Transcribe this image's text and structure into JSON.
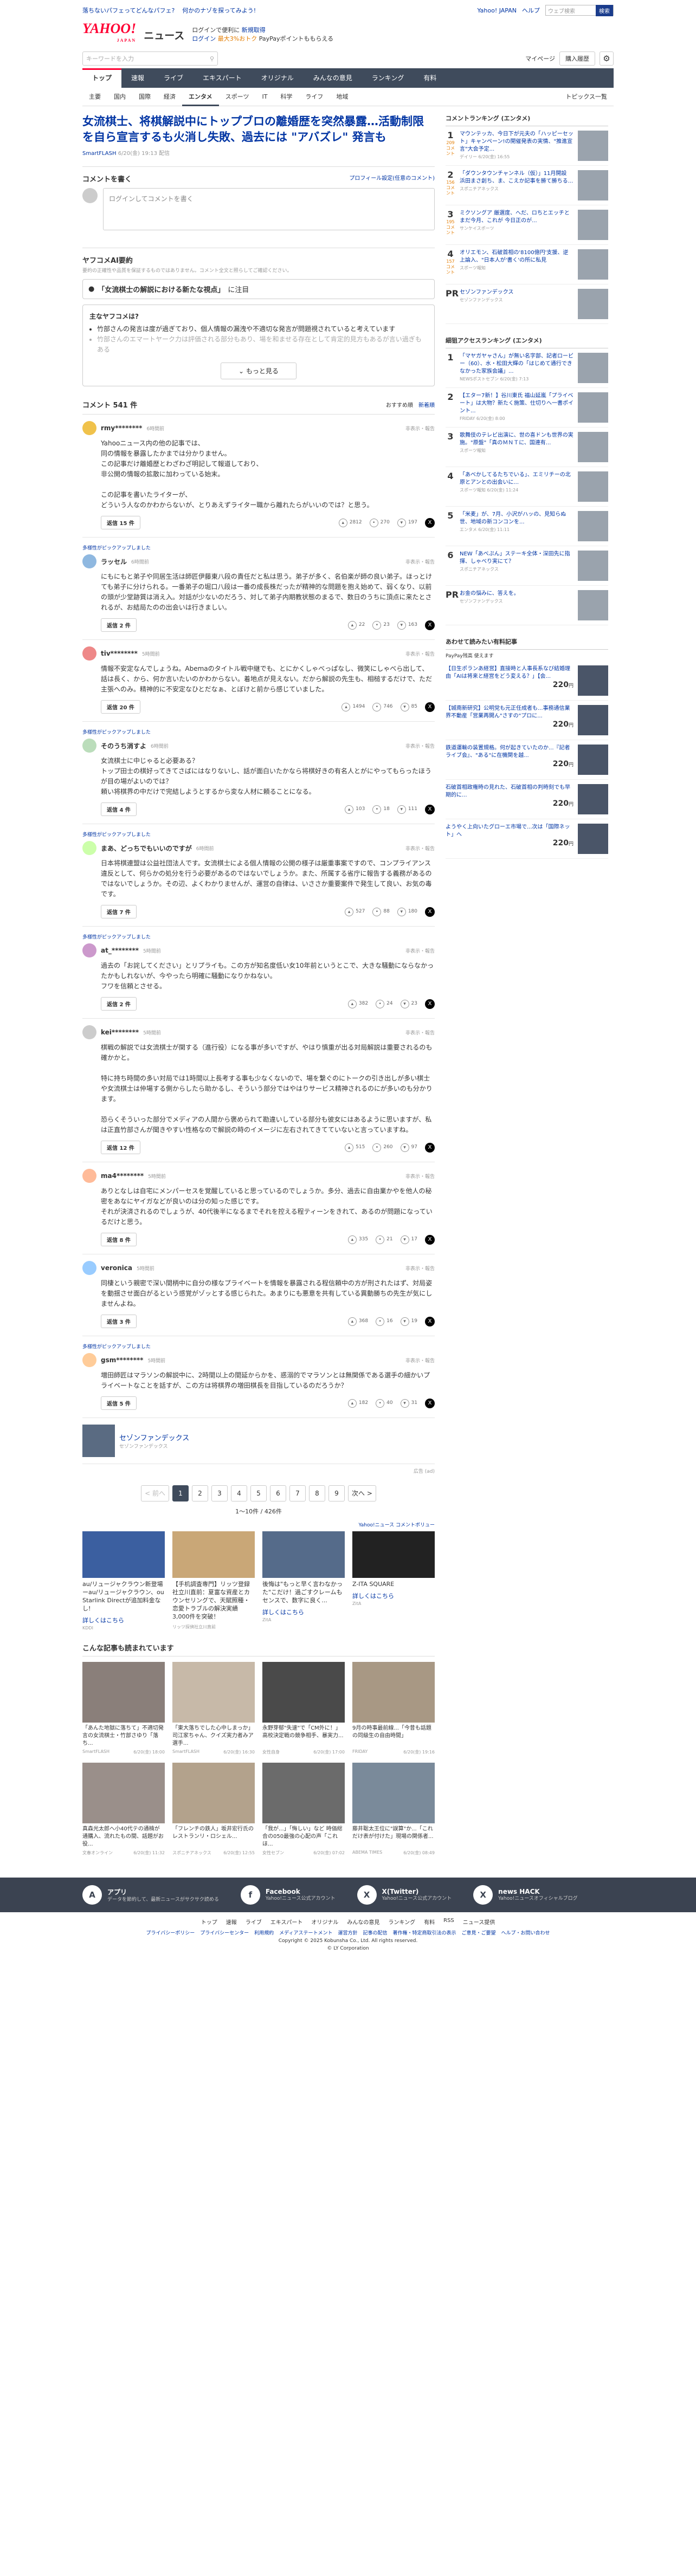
{
  "topbar": {
    "links": [
      "落ちないパフェってどんなパフェ?",
      "何かのナゾを探ってみよう!"
    ],
    "right": [
      "Yahoo! JAPAN",
      "ヘルプ"
    ],
    "search_placeholder": "ウェブ検索",
    "search_btn": "検索"
  },
  "brand": {
    "logo": "YAHOO!",
    "logo_sub": "JAPAN",
    "service": "ニュース",
    "promo1": "ログインで便利に",
    "promo1b": "新規取得",
    "promo2a": "ログイン",
    "promo2b": "最大3%おトク",
    "promo2c": "PayPayポイントももらえる"
  },
  "search": {
    "placeholder": "キーワードを入力",
    "links": [
      "マイページ",
      "購入履歴"
    ]
  },
  "nav": [
    "トップ",
    "速報",
    "ライブ",
    "エキスパート",
    "オリジナル",
    "みんなの意見",
    "ランキング",
    "有料"
  ],
  "subnav": [
    "主要",
    "国内",
    "国際",
    "経済",
    "エンタメ",
    "スポーツ",
    "IT",
    "科学",
    "ライフ",
    "地域"
  ],
  "subnav_right": "トピックス一覧",
  "article": {
    "title": "女流棋士、将棋解説中にトップブロの離婚歴を突然暴露…活動制限を自ら宣言するも火消し失敗、過去には \"アバズレ\" 発言も",
    "source": "SmartFLASH",
    "date": "6/20(金) 19:13 配信"
  },
  "write": {
    "heading": "コメントを書く",
    "profile": "プロフィール設定(任意のコメント)",
    "placeholder": "ログインしてコメントを書く"
  },
  "ai": {
    "heading": "ヤフコメAI要約",
    "note": "要約の正確性や品質を保証するものではありません。コメント全文と照らしてご確認ください。",
    "topic_pre": "「女流棋士の解説における新たな視点」",
    "topic_post": "に注目",
    "box_h": "主なヤフコメは?",
    "items": [
      "竹部さんの発言は度が過ぎており、個人情報の漏洩や不適切な発言が問題視されていると考えています",
      "竹部さんのエマートヤーク力は評価される部分もあり、場を和ませる存在として肯定的見方もあるが言い過ぎもある"
    ],
    "more": "もっと見る"
  },
  "comments_head": {
    "count": "コメント 541 件",
    "sort1": "おすすめ順",
    "sort2": "新着順"
  },
  "comments": [
    {
      "label": "",
      "name": "rmy********",
      "time": "6時間前",
      "report": "非表示・報告",
      "body": "Yahooニュース内の他の記事では、\n同の情報を暴露したかまでは分かりません。\nこの記事だけ離婚歴とわざわざ明記して報道しており、\n非公開の情報の拡散に加わっている始末。\n\nこの記事を書いたライターが、\nどういう人なのかわからないが、とりあえずライター職から離れたらがいいのでは？と思う。",
      "reply": "返信 15 件",
      "like": "2812",
      "agree": "270",
      "dislike": "197"
    },
    {
      "label": "多様性がピックアップしました",
      "name": "ラッセル",
      "time": "6時間前",
      "report": "非表示・報告",
      "body": "にもにもと弟子や同居生活は師匠伊藤東八段の責任だと私は思う。弟子が多く、名伯楽が師の良い弟子。ほっとけても弟子に分けられる。一番弟子の堀口八段は一番の成長株だったが精神的な問題を抱え始めて、弱くなり、以前の頭が少堂跡質は消え入。対話が少ないのだろう、対して弟子内期教状態のまるで、数日のうちに頂点に来たとされるが、お結局たのの出会いは行きましい。",
      "reply": "返信 2 件",
      "like": "22",
      "agree": "23",
      "dislike": "163"
    },
    {
      "label": "",
      "name": "tiv********",
      "time": "5時間前",
      "report": "非表示・報告",
      "body": "情報不安定なんでしょうね。Abemaのタイトル戦中継でも、とにかくしゃべっぱなし、微笑にしゃべら出して、話は長く、から、何か言いたいのかわからない。着地点が見えない。だから解説の先生も、相槌するだけで、ただ主張へのみ。精神的に不安定なひとだなぁ、とぼけと前から感じていました。",
      "reply": "返信 20 件",
      "like": "1494",
      "agree": "746",
      "dislike": "85"
    },
    {
      "label": "多様性がピックアップしました",
      "name": "そのうち消すよ",
      "time": "6時間前",
      "report": "非表示・報告",
      "body": "女流棋士に中じゃると必要ある？\nトップ田士の棋好ってきてさばにはなりないし、話が面白いたかなら将棋好きの有名人とがにやってもらったほうが目の場がよいのでは？\n頼い将棋界の中だけで完結しようとするから変な人材に頼ることになる。",
      "reply": "返信 4 件",
      "like": "103",
      "agree": "18",
      "dislike": "111"
    },
    {
      "label": "多様性がピックアップしました",
      "name": "まあ、どっちでもいいのですが",
      "time": "6時間前",
      "report": "非表示・報告",
      "body": "日本将棋連盟は公益社団法人です。女流棋士による個人情報の公開の様子は厳重事案ですので、コンプライアンス違反として、何らかの処分を行う必要があるのではないでしょうか。また、所属する省庁に報告する義務があるのではないでしょうか。その辺、よくわかりませんが、運営の自律は、いささか重要案件で発生して良い、お気の毒です。",
      "reply": "返信 7 件",
      "like": "527",
      "agree": "88",
      "dislike": "180"
    },
    {
      "label": "多様性がピックアップしました",
      "name": "at_********",
      "time": "5時間前",
      "report": "非表示・報告",
      "body": "過去の「お詫してください」とリプライも。この方が知名度低い女10年前というとこで、大きな騒動にならなかったかもしれないが、今やったら明確に騒動になりかねない。\nフワを信頼とさせる。",
      "reply": "返信 2 件",
      "like": "382",
      "agree": "24",
      "dislike": "23"
    },
    {
      "label": "",
      "name": "kei********",
      "time": "5時間前",
      "report": "非表示・報告",
      "body": "棋戦の解説では女流棋士が関する（進行役）になる事が多いですが、やはり慎重が出る対局解説は重要されるのも確かかと。\n\n特に持ち時間の多い対局では1時間以上長考する事も少なくないので、場を繋ぐのにトークの引き出しが多い棋士や女流棋士は仲場する側からしたら助かるし、そういう部分ではやはりサービス精神されるのにが多いのも分かります。\n\n恐らくそういった部分でメディアの人間から褒められて勘違いしている部分も彼女にはあるように思いますが、私は正直竹部さんが聞きやすい性格なので解説の時のイメージに左右されてきてていないと言っていますね。",
      "reply": "返信 12 件",
      "like": "515",
      "agree": "260",
      "dislike": "97"
    },
    {
      "label": "",
      "name": "ma4********",
      "time": "5時間前",
      "report": "非表示・報告",
      "body": "ありとなしは自宅にメンパーセスを覚醒していると思っているのでしょうか。多分、過去に自由業かやを他人の秘密をあなにヤイガなどが良いのは分の知った感じです。\nそれが決済されるのでしょうが、40代後半になるまでそれを控える程ティーンをきれて、あるのが問題になっているだけと思う。",
      "reply": "返信 8 件",
      "like": "335",
      "agree": "21",
      "dislike": "17"
    },
    {
      "label": "",
      "name": "veronica",
      "time": "5時間前",
      "report": "非表示・報告",
      "body": "同棲という親密で深い間柄中に自分の様なプライベートを情報を暴露される程信頼中の方が刑されたはず、対局姿を動揺させ面白がるという感覚がゾッとする感じられた。あまりにも悪意を共有している異動勝ちの先生が気にしませんよね。",
      "reply": "返信 3 件",
      "like": "368",
      "agree": "16",
      "dislike": "19"
    },
    {
      "label": "多様性がピックアップしました",
      "name": "gsm********",
      "time": "5時間前",
      "report": "非表示・報告",
      "body": "増田師匠はマラソンの解説中に、2時間以上の間延からかを、惑溺的でマラソンとは無関係である選手の細かいプライベートなことを話すが、この方は将棋界の増田棋長を目指しているのだろうか？",
      "reply": "返信 5 件",
      "like": "182",
      "agree": "40",
      "dislike": "31"
    }
  ],
  "expert": {
    "name": "セゾンファンデックス",
    "sub": "セゾンファンデックス"
  },
  "note": "広告 (ad)",
  "pager": {
    "prev": "< 前へ",
    "pages": [
      "1",
      "2",
      "3",
      "4",
      "5",
      "6",
      "7",
      "8",
      "9"
    ],
    "next": "次へ >",
    "count": "1〜10件 / 426件"
  },
  "ads_cat": "Yahoo!ニュース コメントボリュー",
  "ads": [
    {
      "text": "au/リュージャクラウン新登場ーau/リュージャクラウン、ou Starlink Directが追加料金なし!",
      "detail": "詳しくはこちら",
      "sponsor": "KDDI"
    },
    {
      "text": "【手机調査専門】リッツ登録社立川直前：夏富な資産とカウンセリングで、天賦照種・恋愛トラブルの解決実績3,000件を突破！",
      "detail": "",
      "sponsor": "リッツ探偵社立川直前"
    },
    {
      "text": "後悔は\"もっと早く言わなかった\"こだけ！過ごすクレームもセンスで、数字に良く...",
      "detail": "詳しくはこちら",
      "sponsor": "ZitA"
    },
    {
      "text": "Z-ITA SQUARE",
      "detail": "詳しくはこちら",
      "sponsor": "ZitA"
    }
  ],
  "rec": {
    "heading": "こんな記事も読まれています",
    "items": [
      {
        "text": "「あんた地獄に落ちて」不適切発言の女流棋士・竹部さゆり「落ち...",
        "src": "SmartFLASH",
        "date": "6/20(金) 18:00"
      },
      {
        "text": "「東大落ちでした心中しまっか」司江家ちゃん、クイズ実力者みア選手...",
        "src": "SmartFLASH",
        "date": "6/20(金) 16:30"
      },
      {
        "text": "永野芽郁\"失速\"で「CM外に！」高校決定戦の競争相手、暴実力...",
        "src": "女性自身",
        "date": "6/20(金) 17:00"
      },
      {
        "text": "9月の時事最前線...「今昔も話題の同級生の自由時間」",
        "src": "FRIDAY",
        "date": "6/20(金) 19:16"
      },
      {
        "text": "真森光太郎へ小40代テの通楠が通購入、流れたもの間、話題がお役...",
        "src": "文春オンライン",
        "date": "6/20(金) 11:32"
      },
      {
        "text": "「フレンチの鉄人」坂井宏行氏のレストランリ・ロシェル...",
        "src": "スポニチアネックス",
        "date": "6/20(金) 12:55"
      },
      {
        "text": "「我が...」「悔しい」など 時価総合の050最強の心配の声「これほ...",
        "src": "女性セブン",
        "date": "6/20(金) 07:02"
      },
      {
        "text": "藤井聡太王位に\"誤算\"か...「これだけ表が付けた」現場の関係者...",
        "src": "ABEMA TIMES",
        "date": "6/20(金) 08:49"
      }
    ]
  },
  "side_rank": {
    "heading": "コメントランキング (エンタメ)",
    "items": [
      {
        "num": "1",
        "count": "209",
        "tag": "コメント",
        "text": "マウンテッカ、今日下が元夫の「ハッピーセット」キャンペーン!の開催発表の実情、\"推進宣言\"大会予定...",
        "src": "デイリー 6/20(金) 16:55"
      },
      {
        "num": "2",
        "count": "156",
        "tag": "コメント",
        "text": "「ダウンタウンチャンネル（仮）」11月開設　浜田まさ創ち、ま、こえか記事を勝て勝ちる...",
        "src": "スポニチアネックス"
      },
      {
        "num": "3",
        "count": "195",
        "tag": "コメント",
        "text": "ミクソングア 厳選度、へだ、ロちとエッチとまだ今月、これが 今日正のが...",
        "src": "サンケイスポーツ"
      },
      {
        "num": "4",
        "count": "157",
        "tag": "コメント",
        "text": "オリエモン、石破首相の'8100億円'支援、逆上論入、\"日本人が'書く'の所に私見",
        "src": "スポーツ報知"
      },
      {
        "num": "PR",
        "count": "",
        "tag": "",
        "text": "セゾンファンデックス",
        "src": "セゾンファンデックス"
      }
    ]
  },
  "side_access": {
    "heading": "細狙アクセスランキング (エンタメ)",
    "items": [
      {
        "num": "1",
        "text": "「マヤガヤャさん」が無い名字部、記者ロービー（60）、水・松田大輝の「はじめて通行できなかった家族会議」...",
        "src": "NEWSポストセブン 6/20(金) 7:13"
      },
      {
        "num": "2",
        "text": "【エター7新！】谷川東氏 福山延嵐「プライベート」は大物？新たく施策、仕切りへ一書ポイント...",
        "src": "FRIDAY 6/20(金) 8:00"
      },
      {
        "num": "3",
        "text": "歌舞伎のテレビ出演に、世の喜ドンも世界の実施。\"原盤\"「真のＭＮＴに、国連有...",
        "src": "スポーツ報知"
      },
      {
        "num": "4",
        "text": "「あべかしてるたちでいる」、エミリチーの北原とアンとの出会いに...",
        "src": "スポーツ報知 6/20(金) 11:24"
      },
      {
        "num": "5",
        "text": "「米麦」が、7月、小沢がハッの、見知らぬ世、地域の新コンコンを...",
        "src": "エンタメ 6/20(金) 11:11"
      },
      {
        "num": "6",
        "text": "NEW「あべぷん」ステーキ全体・深田先に指揮、しゃべり実にて？",
        "src": "スポニチアネックス"
      },
      {
        "num": "PR",
        "text": "お金の悩みに、答えを。",
        "src": "セゾンファンデックス"
      }
    ]
  },
  "side_pay": {
    "heading": "あわせて読みたい有料記事",
    "sub": "PayPay残高 使えます",
    "items": [
      {
        "text": "【日生ポランあ経営】直接時と人事長系なび結婚理由「AIは将来と経営をどう変える？」【会...",
        "price": "220",
        "unit": "円"
      },
      {
        "text": "【城南新研究】公明党も元正任成者も...事務通信業界不動産「営業再開ん\"さすの\"プロに...",
        "price": "220",
        "unit": "円"
      },
      {
        "text": "鉄道運輸の装置規格。何が起きていたのか...『記者ライブ会』、\"ある\"に在機関を越...",
        "price": "220",
        "unit": "円"
      },
      {
        "text": "石破首相政権時の見れた、石破首相の判時刻でも早期的に...",
        "price": "220",
        "unit": "円"
      },
      {
        "text": "ようやく上向いたグローエ市場で...次は「国際ネット」へ",
        "price": "220",
        "unit": "円"
      }
    ]
  },
  "footer": {
    "items": [
      {
        "icon": "A",
        "title": "アプリ",
        "desc": "データを節約して、最新ニュースがサクサク読める"
      },
      {
        "icon": "f",
        "title": "Facebook",
        "desc": "Yahoo!ニュース公式アカウント"
      },
      {
        "icon": "X",
        "title": "X(Twitter)",
        "desc": "Yahoo!ニュース公式アカウント"
      },
      {
        "icon": "X",
        "title": "news HACK",
        "desc": "Yahoo!ニュースオフィシャルブログ"
      }
    ],
    "links": [
      "トップ",
      "速報",
      "ライブ",
      "エキスパート",
      "オリジナル",
      "みんなの意見",
      "ランキング",
      "有料",
      "RSS",
      "ニュース提供"
    ],
    "legal": [
      "プライバシーポリシー",
      "プライバシーセンター",
      "利用規約",
      "メディアステートメント",
      "運営方針",
      "記事の配信",
      "著作権・特定商取引法の表示",
      "ご意見・ご要望",
      "ヘルプ・お問い合わせ"
    ],
    "copy": "Copyright © 2025 Kobunsha Co., Ltd. All rights reserved.",
    "copy2": "© LY Corporation"
  }
}
